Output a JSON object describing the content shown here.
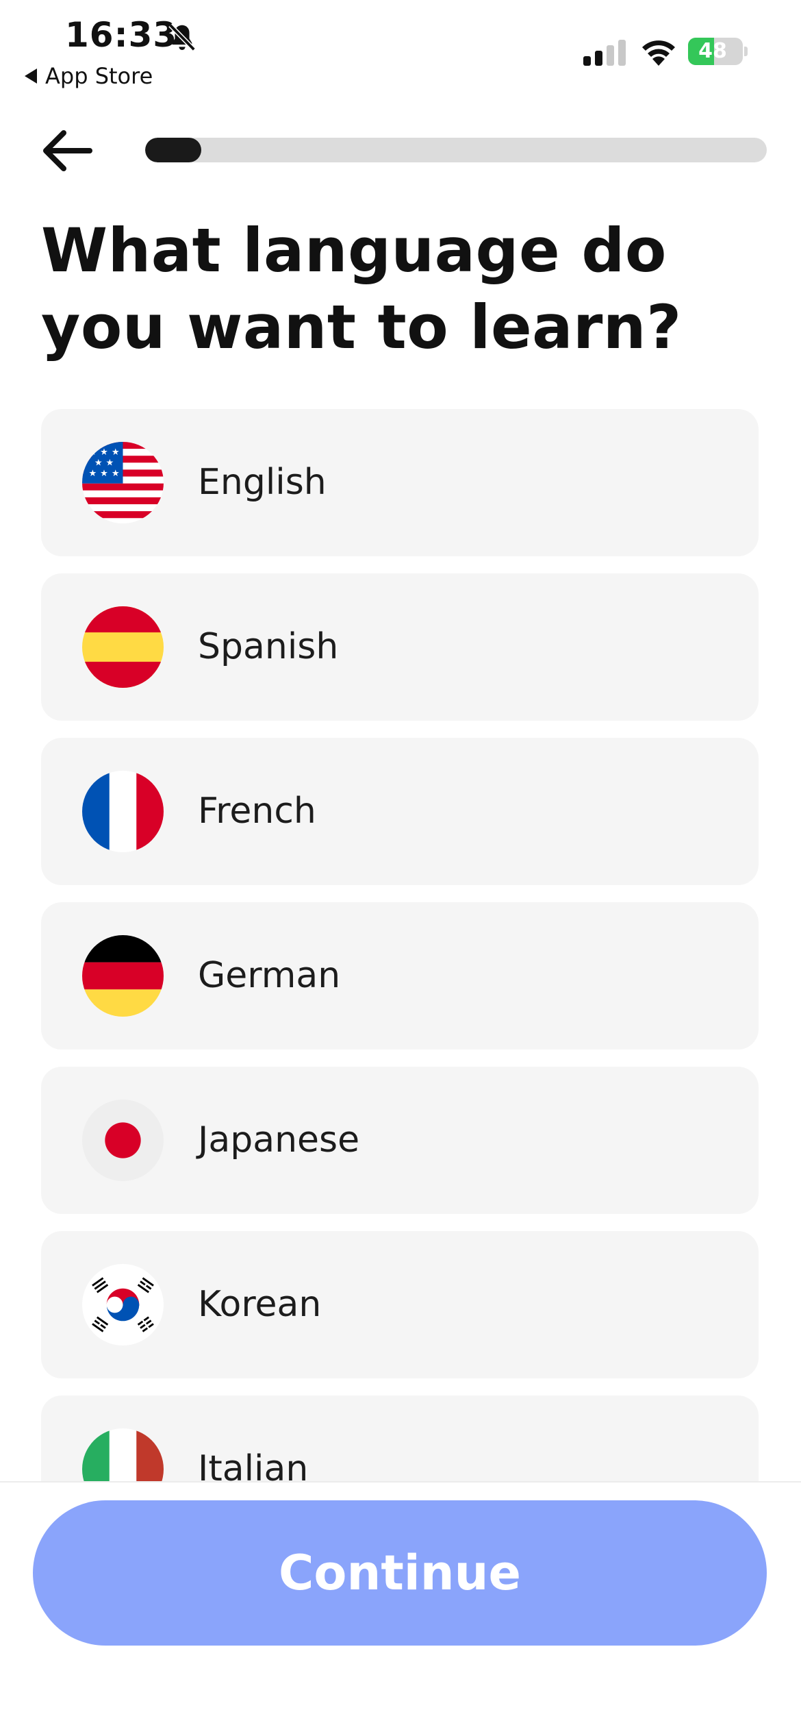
{
  "status_bar": {
    "time": "16:33",
    "back_app": "App Store",
    "battery_percent": 48,
    "battery_text": "48"
  },
  "header": {
    "progress": 0.09
  },
  "title": "What language do you want to learn?",
  "languages": [
    {
      "label": "English",
      "flag": "us-flag-icon"
    },
    {
      "label": "Spanish",
      "flag": "spain-flag-icon"
    },
    {
      "label": "French",
      "flag": "france-flag-icon"
    },
    {
      "label": "German",
      "flag": "germany-flag-icon"
    },
    {
      "label": "Japanese",
      "flag": "japan-flag-icon"
    },
    {
      "label": "Korean",
      "flag": "korea-flag-icon"
    },
    {
      "label": "Italian",
      "flag": "italy-flag-icon"
    }
  ],
  "footer": {
    "continue_label": "Continue",
    "continue_color": "#8aa4fb"
  },
  "colors": {
    "battery_green": "#34c759",
    "progress_fill": "#1a1a1a"
  }
}
